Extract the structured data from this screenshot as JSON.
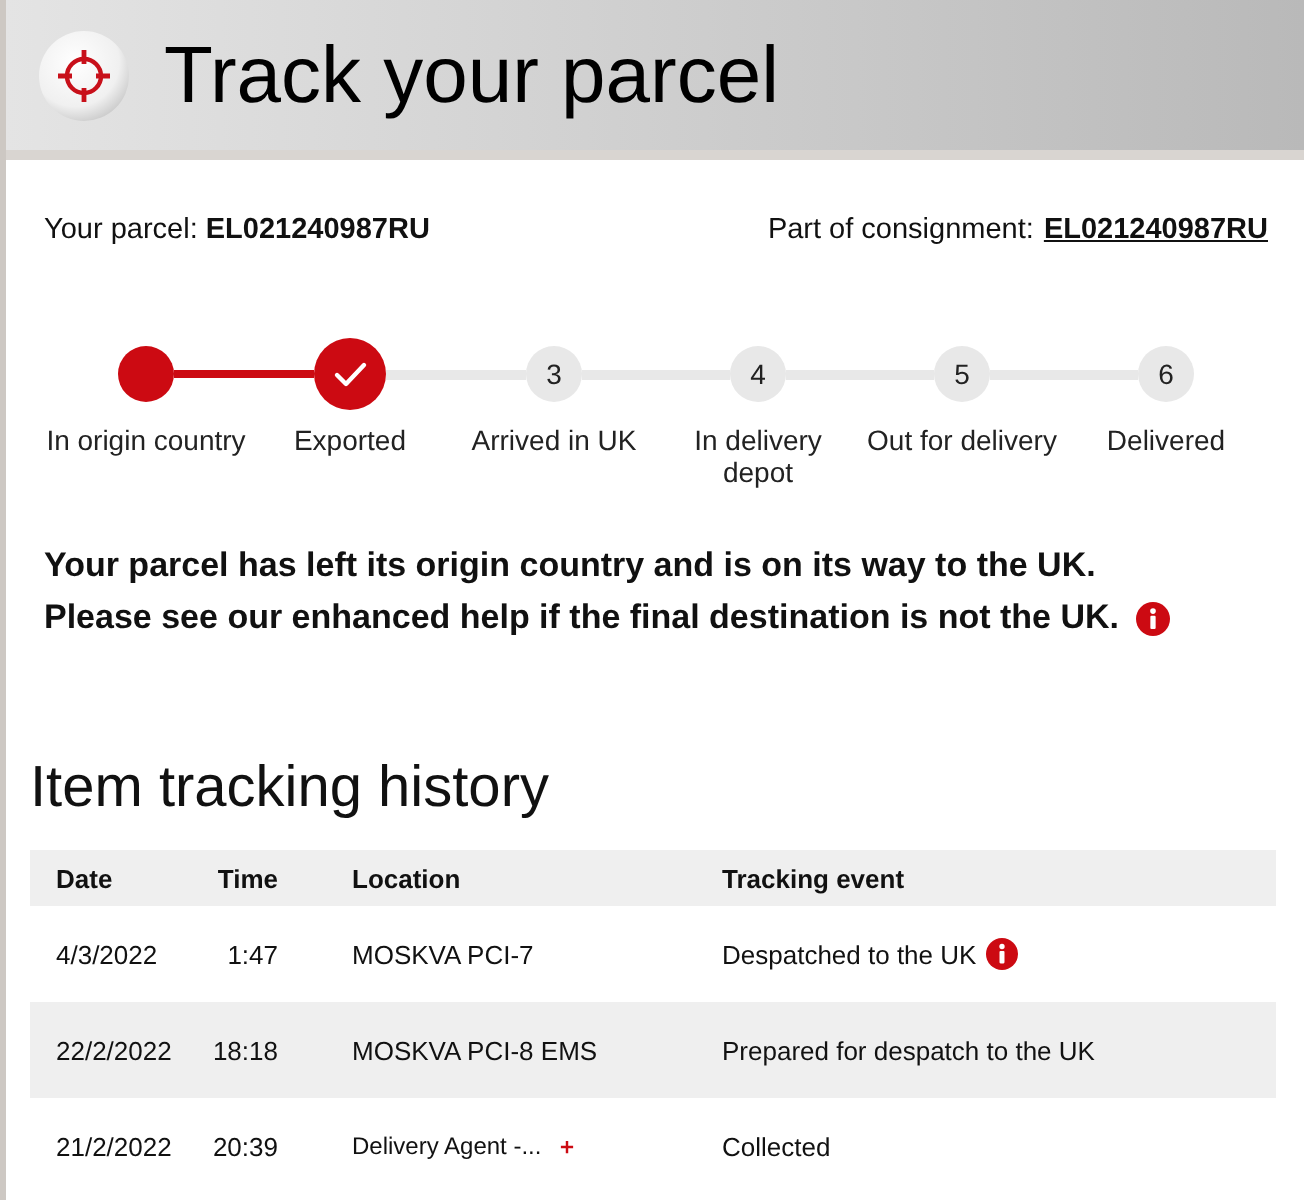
{
  "header": {
    "title": "Track your parcel"
  },
  "parcel": {
    "label": "Your parcel:",
    "number": "EL021240987RU"
  },
  "consignment": {
    "label": "Part of consignment:",
    "number": "EL021240987RU"
  },
  "progress": {
    "steps": [
      {
        "label": "In origin country",
        "completed": true,
        "current": false
      },
      {
        "label": "Exported",
        "completed": true,
        "current": true
      },
      {
        "label": "Arrived in UK",
        "completed": false,
        "current": false,
        "number": "3"
      },
      {
        "label": "In delivery depot",
        "completed": false,
        "current": false,
        "number": "4"
      },
      {
        "label": "Out for delivery",
        "completed": false,
        "current": false,
        "number": "5"
      },
      {
        "label": "Delivered",
        "completed": false,
        "current": false,
        "number": "6"
      }
    ]
  },
  "message": {
    "lines": [
      "Your parcel has left its origin country and is on its way to the UK.",
      "Please see our enhanced help if the final destination is not the UK."
    ],
    "info": true
  },
  "history": {
    "title": "Item tracking history",
    "columns": [
      "Date",
      "Time",
      "Location",
      "Tracking event"
    ],
    "rows": [
      {
        "date": "4/3/2022",
        "time": "1:47",
        "location": "MOSKVA PCI-7",
        "event": "Despatched to the UK",
        "info": true,
        "expandable": false
      },
      {
        "date": "22/2/2022",
        "time": "18:18",
        "location": "MOSKVA PCI-8 EMS",
        "event": "Prepared for despatch to the UK",
        "info": false,
        "expandable": false
      },
      {
        "date": "21/2/2022",
        "time": "20:39",
        "location": "Delivery Agent -...",
        "event": "Collected",
        "info": false,
        "expandable": true
      }
    ]
  }
}
